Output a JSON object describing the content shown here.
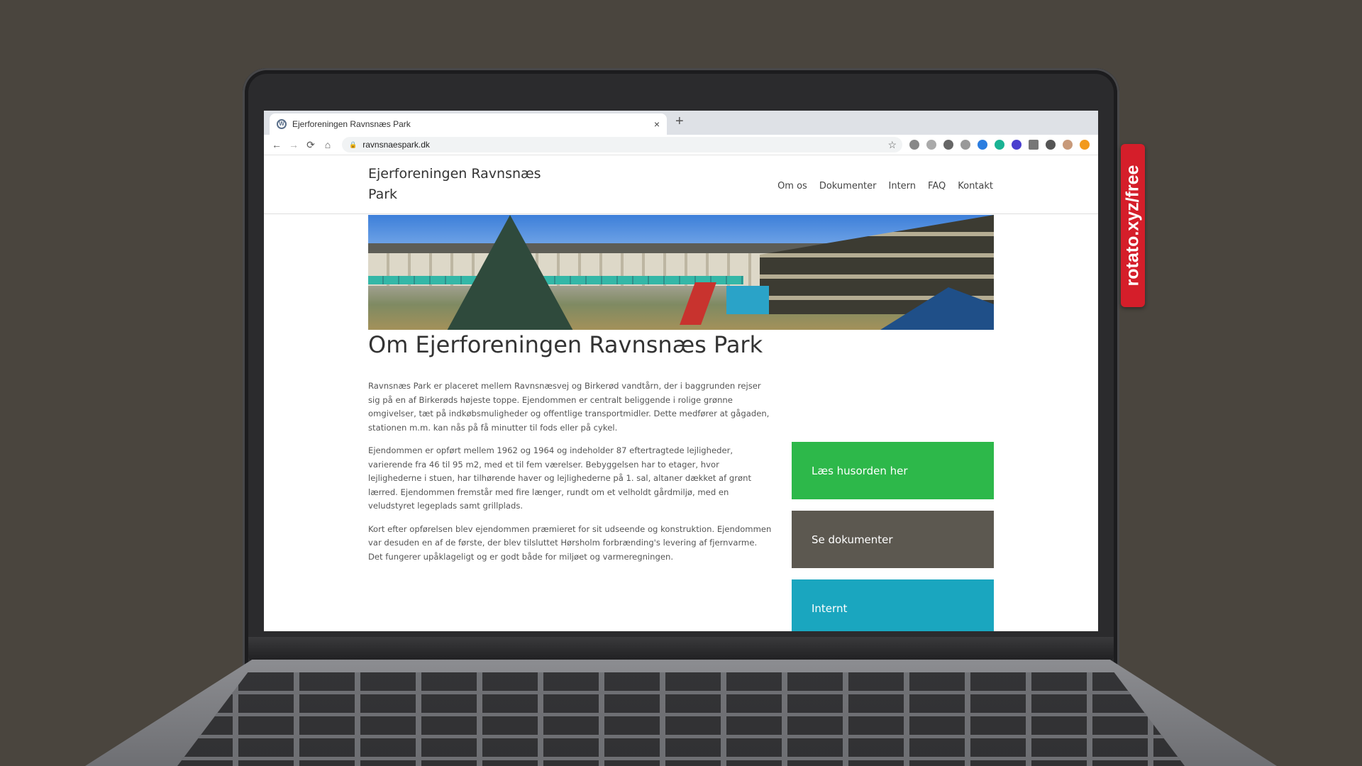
{
  "browser": {
    "tab_title": "Ejerforeningen Ravnsnæs Park",
    "new_tab": "+",
    "close": "×",
    "url": "ravnsnaespark.dk"
  },
  "site": {
    "logo": "Ejerforeningen Ravnsnæs Park",
    "nav": [
      "Om os",
      "Dokumenter",
      "Intern",
      "FAQ",
      "Kontakt"
    ],
    "heading": "Om Ejerforeningen Ravnsnæs Park",
    "paragraphs": [
      "Ravnsnæs Park er placeret mellem Ravnsnæsvej og Birkerød vandtårn, der i baggrunden rejser sig på en af Birkerøds højeste toppe. Ejendommen er centralt beliggende i rolige grønne omgivelser, tæt på indkøbsmuligheder og offentlige transportmidler. Dette medfører at gågaden, stationen m.m. kan nås på få minutter til fods eller på cykel.",
      "Ejendommen er opført mellem 1962 og 1964 og indeholder 87 eftertragtede lejligheder, varierende fra 46 til 95 m2, med et til fem værelser. Bebyggelsen har to etager, hvor lejlighederne i stuen, har tilhørende haver og lejlighederne på 1. sal, altaner dækket af grønt lærred. Ejendommen fremstår med fire længer, rundt om et velholdt gårdmiljø, med en veludstyret legeplads samt grillplads.",
      "Kort efter opførelsen blev ejendommen præmieret for sit udseende og konstruktion. Ejendommen var desuden en af de første, der blev tilsluttet Hørsholm forbrænding's levering af fjernvarme. Det fungerer upåklageligt og er godt både for miljøet og varmeregningen."
    ],
    "buttons": [
      {
        "label": "Læs husorden her",
        "color": "#2db84a"
      },
      {
        "label": "Se dokumenter",
        "color": "#5c5850"
      },
      {
        "label": "Internt",
        "color": "#1aa6bf"
      }
    ]
  },
  "badge": "rotato.xyz/free"
}
